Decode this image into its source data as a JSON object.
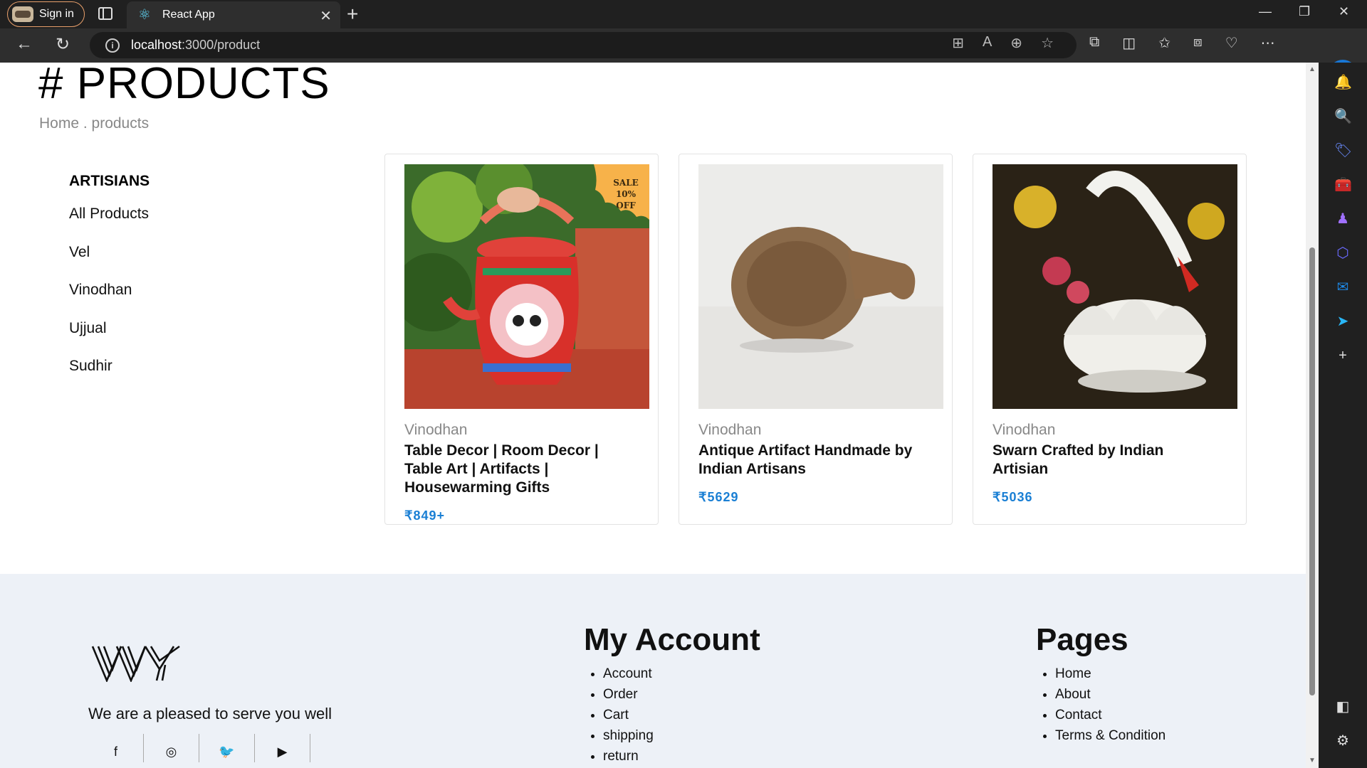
{
  "browser": {
    "signin_label": "Sign in",
    "tab_title": "React App",
    "url_host": "localhost",
    "url_path": ":3000/product"
  },
  "page": {
    "title": "# PRODUCTS",
    "breadcrumb": "Home . products"
  },
  "filters": {
    "heading": "ARTISIANS",
    "items": [
      "All Products",
      "Vel",
      "Vinodhan",
      "Ujjual",
      "Sudhir"
    ]
  },
  "products": [
    {
      "artisan": "Vinodhan",
      "name": "Table Decor | Room Decor | Table Art | Artifacts | Housewarming Gifts",
      "price": "₹849+",
      "badge_line1": "SALE",
      "badge_line2": "10% OFF"
    },
    {
      "artisan": "Vinodhan",
      "name": "Antique Artifact Handmade by Indian Artisans",
      "price": "₹5629"
    },
    {
      "artisan": "Vinodhan",
      "name": "Swarn Crafted by Indian Artisian",
      "price": "₹5036"
    }
  ],
  "footer": {
    "tagline": "We are a pleased to serve you well",
    "my_account": {
      "heading": "My Account",
      "links": [
        "Account",
        "Order",
        "Cart",
        "shipping",
        "return"
      ]
    },
    "pages": {
      "heading": "Pages",
      "links": [
        "Home",
        "About",
        "Contact",
        "Terms & Condition"
      ]
    },
    "social_icons": [
      "facebook-icon",
      "instagram-icon",
      "twitter-icon",
      "youtube-icon"
    ]
  },
  "colors": {
    "price": "#1a7fd4",
    "footer_bg": "#edf1f7",
    "badge": "#f7b24a"
  }
}
